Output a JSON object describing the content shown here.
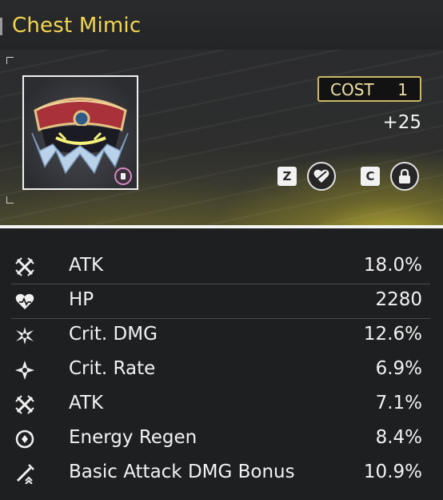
{
  "echo": {
    "name": "Chest Mimic",
    "cost_label": "COST",
    "cost_value": "1",
    "level": "+25",
    "hotkey_favorite": "Z",
    "hotkey_lock": "C"
  },
  "stats": [
    {
      "icon": "crossed-swords-icon",
      "name": "ATK",
      "value": "18.0%"
    },
    {
      "icon": "heart-icon",
      "name": "HP",
      "value": "2280"
    },
    {
      "icon": "crit-dmg-icon",
      "name": "Crit. DMG",
      "value": "12.6%"
    },
    {
      "icon": "crit-rate-icon",
      "name": "Crit. Rate",
      "value": "6.9%"
    },
    {
      "icon": "crossed-swords-icon",
      "name": "ATK",
      "value": "7.1%"
    },
    {
      "icon": "energy-regen-icon",
      "name": "Energy Regen",
      "value": "8.4%"
    },
    {
      "icon": "basic-attack-icon",
      "name": "Basic Attack DMG Bonus",
      "value": "10.9%"
    }
  ],
  "colors": {
    "title": "#f3d651",
    "cost_border": "#cbb86a",
    "background": "#1e1f21",
    "card_glow": "#d4c437"
  }
}
